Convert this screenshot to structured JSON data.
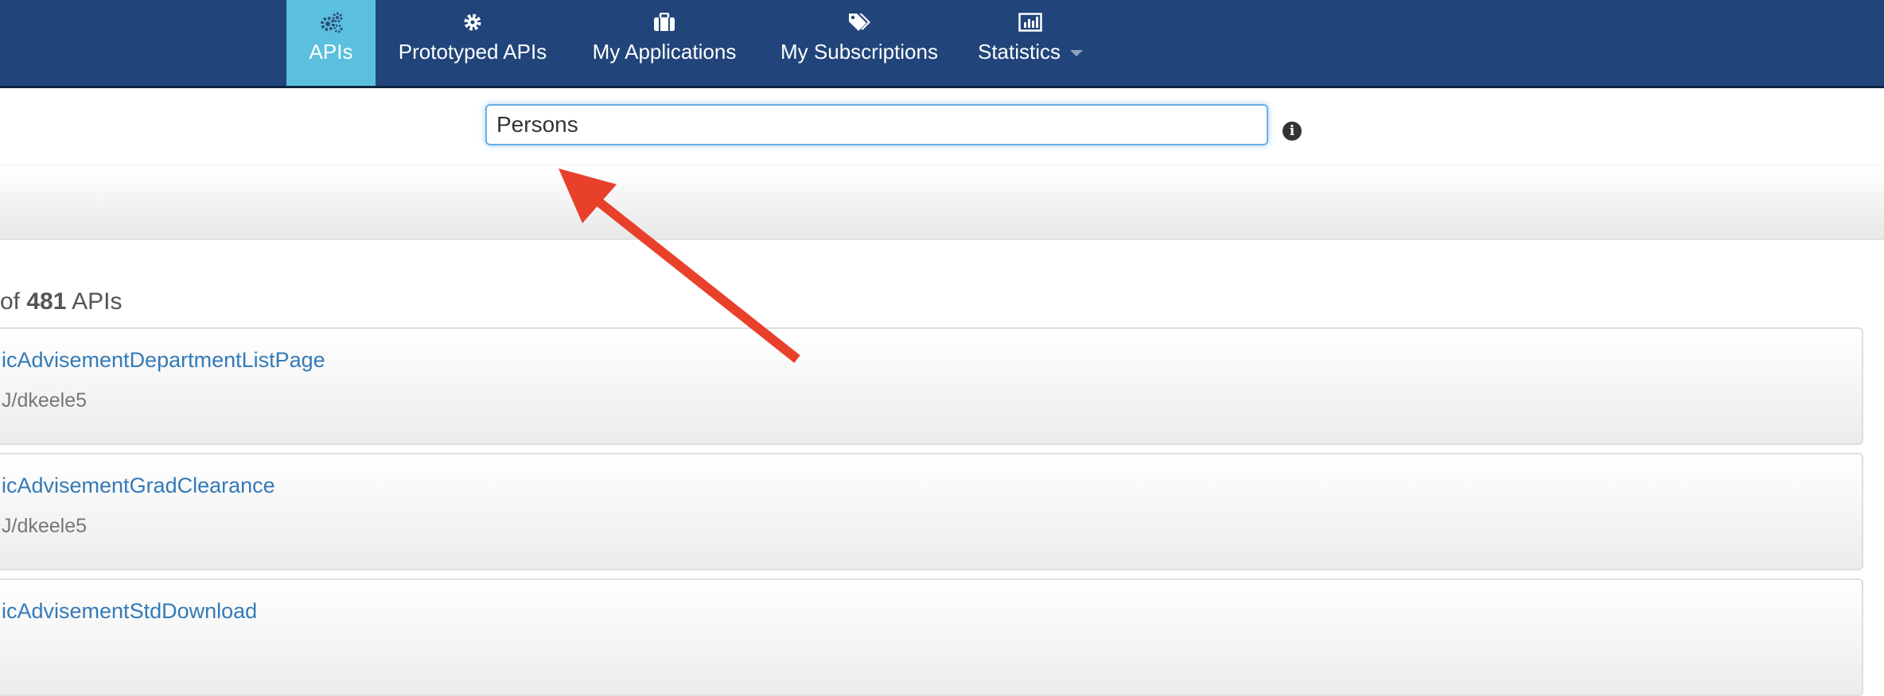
{
  "nav": {
    "items": [
      {
        "label": "APIs",
        "icon": "gears-icon",
        "active": true
      },
      {
        "label": "Prototyped APIs",
        "icon": "gear-icon",
        "active": false
      },
      {
        "label": "My Applications",
        "icon": "briefcase-icon",
        "active": false
      },
      {
        "label": "My Subscriptions",
        "icon": "tags-icon",
        "active": false
      },
      {
        "label": "Statistics",
        "icon": "bar-chart-icon",
        "active": false,
        "has_dropdown": true
      }
    ],
    "background": "#21457a",
    "active_background": "#5bc0de"
  },
  "search": {
    "value": "Persons",
    "info_icon": "info-icon"
  },
  "results": {
    "prefix": "of",
    "total": "481",
    "suffix": "APIs",
    "items": [
      {
        "name": "icAdvisementDepartmentListPage",
        "owner": "J/dkeele5"
      },
      {
        "name": "icAdvisementGradClearance",
        "owner": "J/dkeele5"
      },
      {
        "name": "icAdvisementStdDownload",
        "owner": ""
      }
    ]
  },
  "annotation": {
    "arrow_color": "#e8402a"
  }
}
